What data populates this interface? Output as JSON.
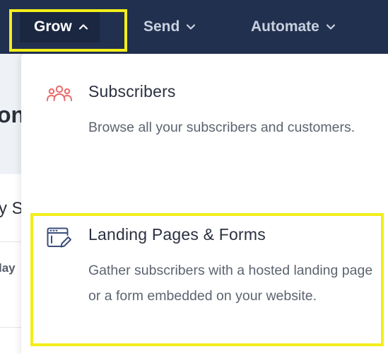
{
  "topnav": {
    "items": [
      {
        "label": "Grow",
        "state": "open",
        "chevron": "chevron-up-icon"
      },
      {
        "label": "Send",
        "chevron": "chevron-down-icon"
      },
      {
        "label": "Automate",
        "chevron": "chevron-down-icon"
      }
    ],
    "colors": {
      "background": "#22304f",
      "active": "#1b2640",
      "highlight": "#f3ee1a"
    }
  },
  "background_page": {
    "fragments": [
      "on",
      "y Su",
      "lay"
    ]
  },
  "dropdown": {
    "items": [
      {
        "icon": "users-icon",
        "icon_color": "#ea6a6a",
        "title": "Subscribers",
        "description": "Browse all your subscribers and customers."
      },
      {
        "icon": "form-edit-icon",
        "icon_color": "#3a4f7a",
        "title": "Landing Pages & Forms",
        "description": "Gather subscribers with a hosted landing page or a form embedded on your website."
      }
    ]
  }
}
